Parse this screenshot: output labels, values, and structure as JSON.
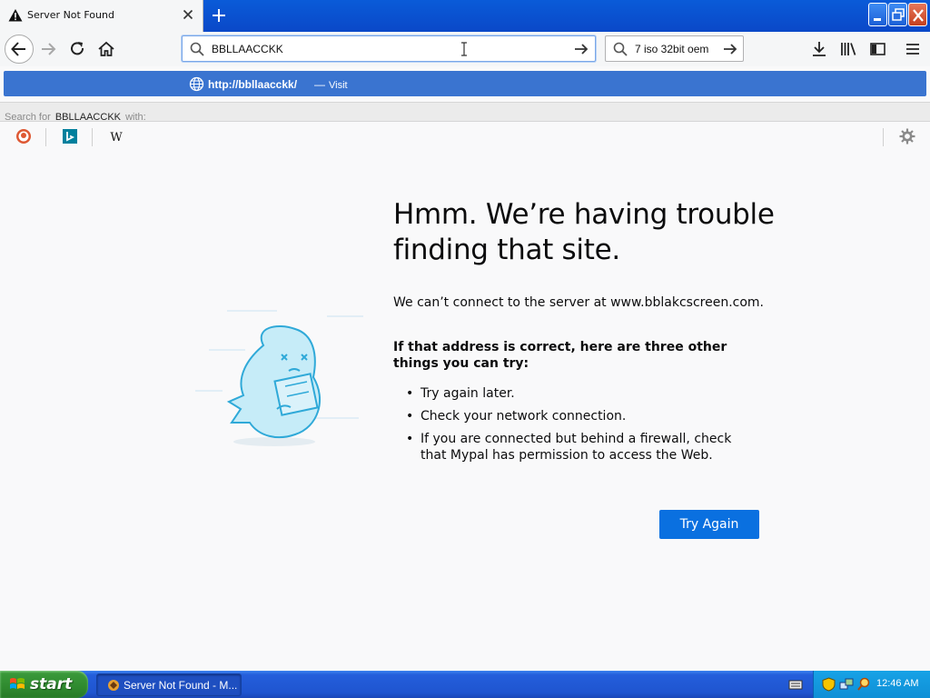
{
  "tab": {
    "title": "Server Not Found"
  },
  "urlbar": {
    "value": "BBLLAACCKK"
  },
  "searchbar": {
    "value": "7 iso 32bit oem"
  },
  "suggestion": {
    "url": "http://bbllaacckk/",
    "separator": "—",
    "action": "Visit"
  },
  "search_for": {
    "prefix": "Search for",
    "query": "BBLLAACCKK",
    "suffix": "with:"
  },
  "engines": [
    "duckduckgo-icon",
    "bing-icon",
    "wikipedia-icon"
  ],
  "error_page": {
    "title": "Hmm. We’re having trouble finding that site.",
    "description": "We can’t connect to the server at www.bblakcscreen.com.",
    "subheading": "If that address is correct, here are three other things you can try:",
    "tips": [
      "Try again later.",
      "Check your network connection.",
      "If you are connected but behind a firewall, check that Mypal has permission to access the Web."
    ],
    "button_label": "Try Again"
  },
  "taskbar": {
    "start_label": "start",
    "task_label": "Server Not Found - M...",
    "clock": "12:46 AM"
  },
  "colors": {
    "accent": "#0a70e0",
    "suggest_row": "#3a74d0",
    "titlebar": "#0a5bd8"
  }
}
